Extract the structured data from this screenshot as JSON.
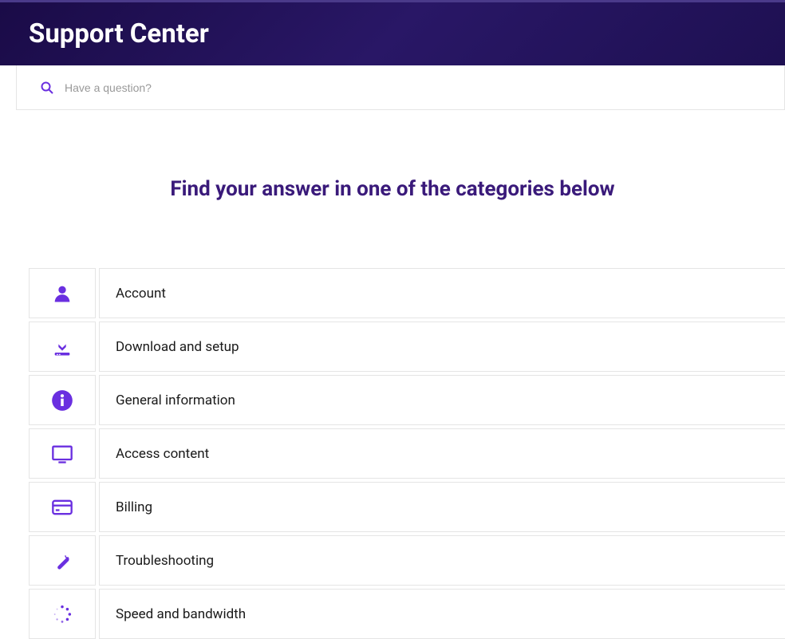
{
  "header": {
    "title": "Support Center"
  },
  "search": {
    "placeholder": "Have a question?"
  },
  "main": {
    "heading": "Find your answer in one of the categories below"
  },
  "categories": [
    {
      "icon": "user-icon",
      "label": "Account"
    },
    {
      "icon": "download-icon",
      "label": "Download and setup"
    },
    {
      "icon": "info-icon",
      "label": "General information"
    },
    {
      "icon": "monitor-icon",
      "label": "Access content"
    },
    {
      "icon": "credit-card-icon",
      "label": "Billing"
    },
    {
      "icon": "wrench-icon",
      "label": "Troubleshooting"
    },
    {
      "icon": "speed-icon",
      "label": "Speed and bandwidth"
    }
  ]
}
